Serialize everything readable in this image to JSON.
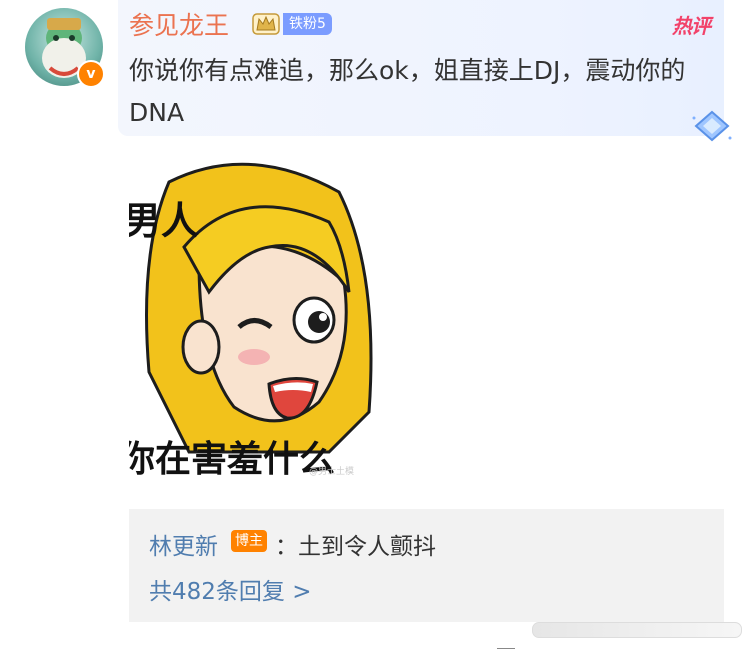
{
  "comment": {
    "username": "参见龙王",
    "fan_badge": "铁粉5",
    "hot_tag": "热评",
    "text": "你说你有点难追，那么ok，姐直接上DJ，震动你的DNA",
    "meme": {
      "top_text": "男人",
      "bottom_text": "你在害羞什么",
      "watermark": "@男士土模"
    }
  },
  "reply_preview": {
    "author": "林更新",
    "author_badge": "博主",
    "text": "：土到令人颤抖",
    "more_link": "共482条回复 >"
  },
  "colors": {
    "username": "#eb7350",
    "link_blue": "#507daf",
    "hot_pink": "#f2426a",
    "badge_orange": "#ff8200",
    "fan_badge": "#7b9cff"
  }
}
